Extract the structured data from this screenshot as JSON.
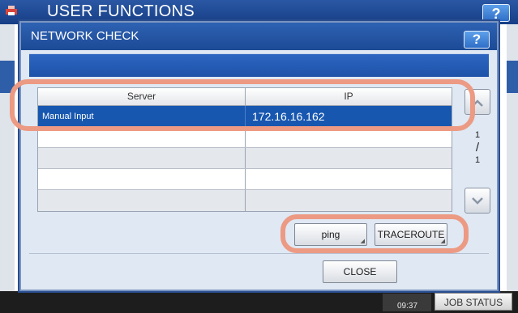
{
  "background": {
    "title": "USER FUNCTIONS",
    "help_label": "?",
    "time": "09:37",
    "job_status_label": "JOB STATUS"
  },
  "dialog": {
    "title": "NETWORK CHECK",
    "help_label": "?"
  },
  "table": {
    "columns": [
      "Server",
      "IP"
    ],
    "rows": [
      {
        "server": "Manual Input",
        "ip": "172.16.16.162",
        "selected": true
      },
      {
        "server": "",
        "ip": ""
      },
      {
        "server": "",
        "ip": ""
      },
      {
        "server": "",
        "ip": ""
      },
      {
        "server": "",
        "ip": ""
      }
    ]
  },
  "pagination": {
    "current": "1",
    "separator": "/",
    "total": "1"
  },
  "buttons": {
    "ping": "ping",
    "traceroute": "TRACEROUTE",
    "close": "CLOSE"
  },
  "icons": {
    "up": "chevron-up-icon",
    "down": "chevron-down-icon",
    "app": "printer-icon"
  },
  "colors": {
    "accent": "#1757b0",
    "title_bar": "#1c4a96",
    "highlight": "#ec9a83"
  }
}
